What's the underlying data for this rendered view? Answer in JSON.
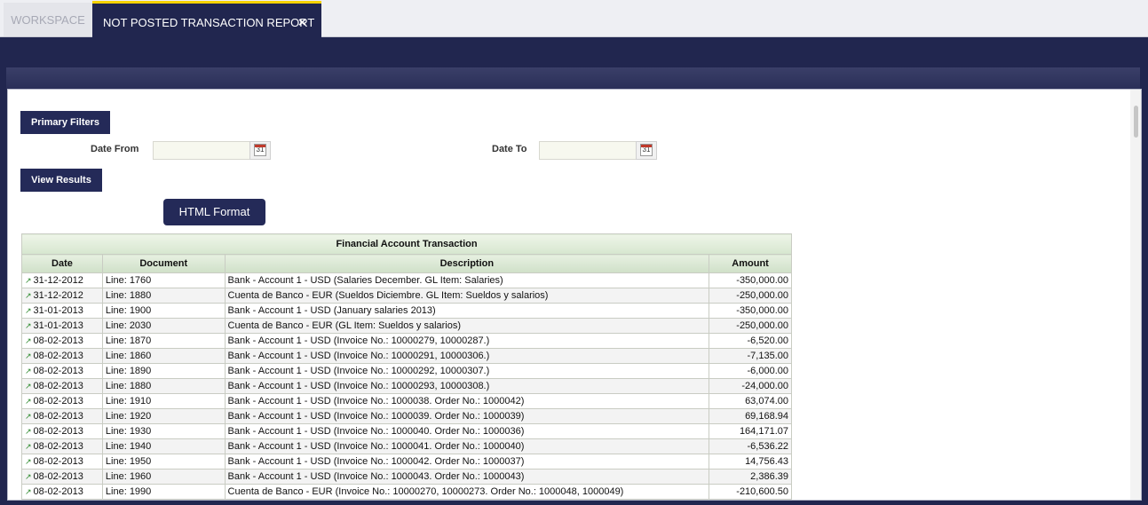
{
  "tabs": [
    {
      "label": "WORKSPACE"
    },
    {
      "label": "NOT POSTED TRANSACTION REPORT",
      "close": "×"
    }
  ],
  "filters": {
    "primary_filters_label": "Primary Filters",
    "date_from_label": "Date From",
    "date_from_value": "",
    "date_to_label": "Date To",
    "date_to_value": "",
    "calendar_glyph": "31",
    "view_results_label": "View Results",
    "html_format_label": "HTML Format"
  },
  "report": {
    "title": "Financial Account Transaction",
    "columns": [
      "Date",
      "Document",
      "Description",
      "Amount"
    ],
    "rows": [
      {
        "date": "31-12-2012",
        "document": "Line: 1760",
        "description": "Bank - Account 1 - USD (Salaries December. GL Item: Salaries)",
        "amount": "-350,000.00"
      },
      {
        "date": "31-12-2012",
        "document": "Line: 1880",
        "description": "Cuenta de Banco - EUR (Sueldos Diciembre. GL Item: Sueldos y salarios)",
        "amount": "-250,000.00"
      },
      {
        "date": "31-01-2013",
        "document": "Line: 1900",
        "description": "Bank - Account 1 - USD (January salaries 2013)",
        "amount": "-350,000.00"
      },
      {
        "date": "31-01-2013",
        "document": "Line: 2030",
        "description": "Cuenta de Banco - EUR (GL Item: Sueldos y salarios)",
        "amount": "-250,000.00"
      },
      {
        "date": "08-02-2013",
        "document": "Line: 1870",
        "description": "Bank - Account 1 - USD (Invoice No.: 10000279, 10000287.)",
        "amount": "-6,520.00"
      },
      {
        "date": "08-02-2013",
        "document": "Line: 1860",
        "description": "Bank - Account 1 - USD (Invoice No.: 10000291, 10000306.)",
        "amount": "-7,135.00"
      },
      {
        "date": "08-02-2013",
        "document": "Line: 1890",
        "description": "Bank - Account 1 - USD (Invoice No.: 10000292, 10000307.)",
        "amount": "-6,000.00"
      },
      {
        "date": "08-02-2013",
        "document": "Line: 1880",
        "description": "Bank - Account 1 - USD (Invoice No.: 10000293, 10000308.)",
        "amount": "-24,000.00"
      },
      {
        "date": "08-02-2013",
        "document": "Line: 1910",
        "description": "Bank - Account 1 - USD (Invoice No.: 1000038. Order No.: 1000042)",
        "amount": "63,074.00"
      },
      {
        "date": "08-02-2013",
        "document": "Line: 1920",
        "description": "Bank - Account 1 - USD (Invoice No.: 1000039. Order No.: 1000039)",
        "amount": "69,168.94"
      },
      {
        "date": "08-02-2013",
        "document": "Line: 1930",
        "description": "Bank - Account 1 - USD (Invoice No.: 1000040. Order No.: 1000036)",
        "amount": "164,171.07"
      },
      {
        "date": "08-02-2013",
        "document": "Line: 1940",
        "description": "Bank - Account 1 - USD (Invoice No.: 1000041. Order No.: 1000040)",
        "amount": "-6,536.22"
      },
      {
        "date": "08-02-2013",
        "document": "Line: 1950",
        "description": "Bank - Account 1 - USD (Invoice No.: 1000042. Order No.: 1000037)",
        "amount": "14,756.43"
      },
      {
        "date": "08-02-2013",
        "document": "Line: 1960",
        "description": "Bank - Account 1 - USD (Invoice No.: 1000043. Order No.: 1000043)",
        "amount": "2,386.39"
      },
      {
        "date": "08-02-2013",
        "document": "Line: 1990",
        "description": "Cuenta de Banco - EUR (Invoice No.: 10000270, 10000273. Order No.: 1000048, 1000049)",
        "amount": "-210,600.50"
      }
    ]
  },
  "colors": {
    "navy": "#21264f",
    "accent_yellow": "#f6d200",
    "link_arrow_green": "#2d8a2d"
  }
}
